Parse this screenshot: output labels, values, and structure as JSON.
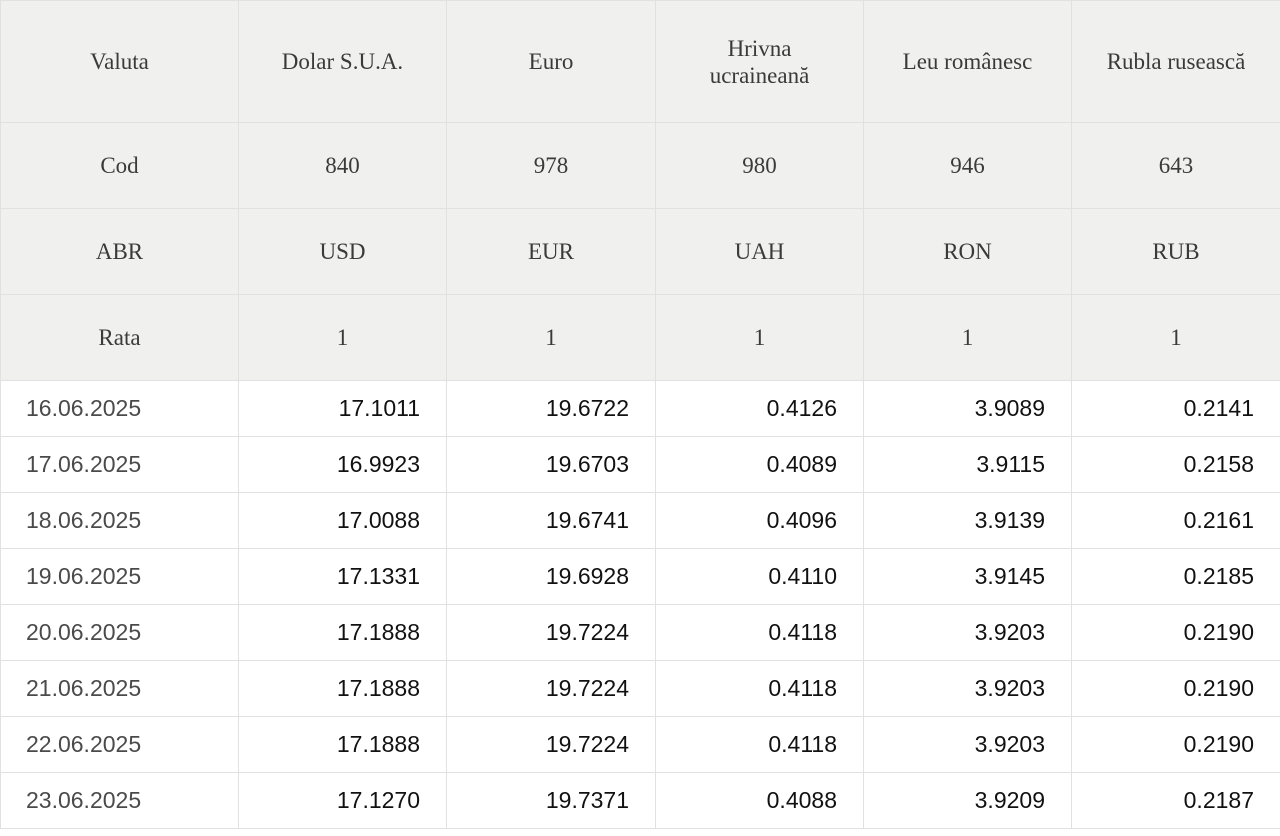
{
  "header": {
    "valuta": {
      "label": "Valuta",
      "currencies": [
        "Dolar S.U.A.",
        "Euro",
        "Hrivna ucraineană",
        "Leu românesc",
        "Rubla rusească"
      ]
    },
    "cod": {
      "label": "Cod",
      "values": [
        "840",
        "978",
        "980",
        "946",
        "643"
      ]
    },
    "abr": {
      "label": "ABR",
      "values": [
        "USD",
        "EUR",
        "UAH",
        "RON",
        "RUB"
      ]
    },
    "rata": {
      "label": "Rata",
      "values": [
        "1",
        "1",
        "1",
        "1",
        "1"
      ]
    }
  },
  "rows": [
    {
      "date": "16.06.2025",
      "values": [
        "17.1011",
        "19.6722",
        "0.4126",
        "3.9089",
        "0.2141"
      ]
    },
    {
      "date": "17.06.2025",
      "values": [
        "16.9923",
        "19.6703",
        "0.4089",
        "3.9115",
        "0.2158"
      ]
    },
    {
      "date": "18.06.2025",
      "values": [
        "17.0088",
        "19.6741",
        "0.4096",
        "3.9139",
        "0.2161"
      ]
    },
    {
      "date": "19.06.2025",
      "values": [
        "17.1331",
        "19.6928",
        "0.4110",
        "3.9145",
        "0.2185"
      ]
    },
    {
      "date": "20.06.2025",
      "values": [
        "17.1888",
        "19.7224",
        "0.4118",
        "3.9203",
        "0.2190"
      ]
    },
    {
      "date": "21.06.2025",
      "values": [
        "17.1888",
        "19.7224",
        "0.4118",
        "3.9203",
        "0.2190"
      ]
    },
    {
      "date": "22.06.2025",
      "values": [
        "17.1888",
        "19.7224",
        "0.4118",
        "3.9203",
        "0.2190"
      ]
    },
    {
      "date": "23.06.2025",
      "values": [
        "17.1270",
        "19.7371",
        "0.4088",
        "3.9209",
        "0.2187"
      ]
    }
  ]
}
